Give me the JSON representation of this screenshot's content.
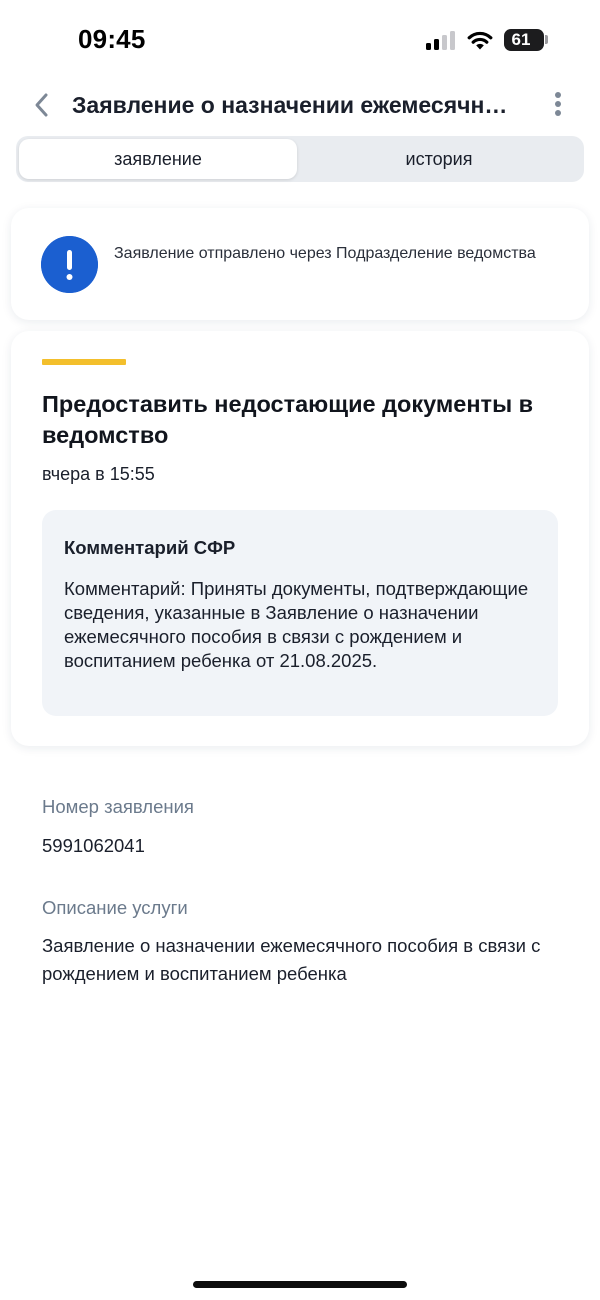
{
  "status_bar": {
    "time": "09:45",
    "battery": "61"
  },
  "header": {
    "title": "Заявление о назначении ежемесячного пособия в связи с рождением и воспитанием ребенка",
    "back_icon": "chevron-left-icon",
    "more_icon": "more-vertical-icon"
  },
  "tabs": [
    {
      "label": "заявление",
      "active": true
    },
    {
      "label": "история",
      "active": false
    }
  ],
  "notice": {
    "icon": "exclamation-icon",
    "text": "Заявление отправлено через Подразделение ведомства"
  },
  "task": {
    "title": "Предоставить недостающие документы в ведомство",
    "time": "вчера в 15:55",
    "comment_title": "Комментарий СФР",
    "comment_text": "Комментарий: Приняты документы, подтверждающие сведения, указанные в Заявление о назначении ежемесячного пособия в связи с рождением и воспитанием ребенка от 21.08.2025."
  },
  "info": {
    "number_label": "Номер заявления",
    "number_value": "5991062041",
    "description_label": "Описание услуги",
    "description_value": "Заявление о назначении ежемесячного пособия в связи с рождением и воспитанием ребенка"
  },
  "colors": {
    "accent_blue": "#1b5fd0",
    "accent_yellow": "#f3bf2c",
    "muted_label": "#6b7a8c",
    "comment_bg": "#f1f4f8"
  }
}
